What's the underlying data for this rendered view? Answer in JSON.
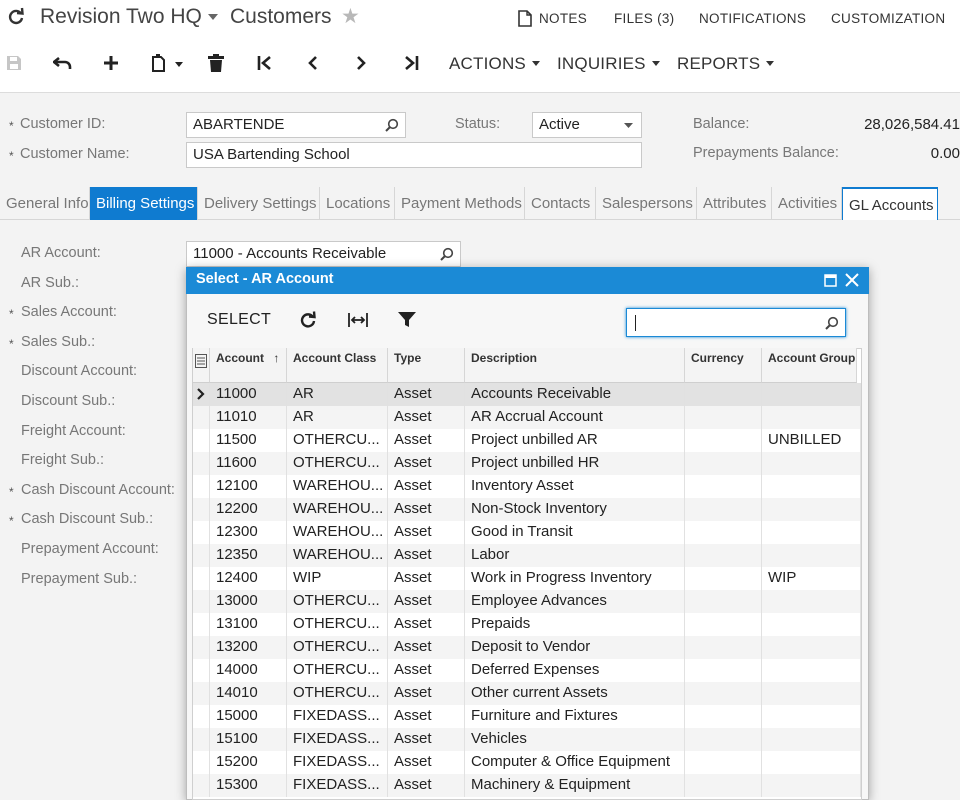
{
  "header": {
    "company": "Revision Two HQ",
    "screen_title": "Customers",
    "links": [
      "NOTES",
      "FILES (3)",
      "NOTIFICATIONS",
      "CUSTOMIZATION"
    ]
  },
  "toolbar": {
    "menus": [
      "ACTIONS",
      "INQUIRIES",
      "REPORTS"
    ]
  },
  "form": {
    "customer_id_label": "Customer ID:",
    "customer_id_value": "ABARTENDE",
    "customer_name_label": "Customer Name:",
    "customer_name_value": "USA Bartending School",
    "status_label": "Status:",
    "status_value": "Active",
    "balance_label": "Balance:",
    "balance_value": "28,026,584.41",
    "prepayments_label": "Prepayments Balance:",
    "prepayments_value": "0.00",
    "required_mark": "*"
  },
  "tabs": [
    "General Info",
    "Billing Settings",
    "Delivery Settings",
    "Locations",
    "Payment Methods",
    "Contacts",
    "Salespersons",
    "Attributes",
    "Activities",
    "GL Accounts"
  ],
  "gl_fields": [
    {
      "label": "AR Account:",
      "required": false
    },
    {
      "label": "AR Sub.:",
      "required": false
    },
    {
      "label": "Sales Account:",
      "required": true
    },
    {
      "label": "Sales Sub.:",
      "required": true
    },
    {
      "label": "Discount Account:",
      "required": false
    },
    {
      "label": "Discount Sub.:",
      "required": false
    },
    {
      "label": "Freight Account:",
      "required": false
    },
    {
      "label": "Freight Sub.:",
      "required": false
    },
    {
      "label": "Cash Discount Account:",
      "required": true
    },
    {
      "label": "Cash Discount Sub.:",
      "required": true
    },
    {
      "label": "Prepayment Account:",
      "required": false
    },
    {
      "label": "Prepayment Sub.:",
      "required": false
    }
  ],
  "ar_account_value": "11000 - Accounts Receivable",
  "dialog": {
    "title": "Select - AR Account",
    "select_label": "SELECT",
    "search_value": "",
    "columns": [
      "Account",
      "Account Class",
      "Type",
      "Description",
      "Currency",
      "Account Group"
    ],
    "sort_indicator": "↑",
    "rows": [
      [
        "11000",
        "AR",
        "Asset",
        "Accounts Receivable",
        "",
        ""
      ],
      [
        "11010",
        "AR",
        "Asset",
        "AR Accrual Account",
        "",
        ""
      ],
      [
        "11500",
        "OTHERCU...",
        "Asset",
        "Project unbilled AR",
        "",
        "UNBILLED"
      ],
      [
        "11600",
        "OTHERCU...",
        "Asset",
        "Project unbilled HR",
        "",
        ""
      ],
      [
        "12100",
        "WAREHOU...",
        "Asset",
        "Inventory Asset",
        "",
        ""
      ],
      [
        "12200",
        "WAREHOU...",
        "Asset",
        "Non-Stock Inventory",
        "",
        ""
      ],
      [
        "12300",
        "WAREHOU...",
        "Asset",
        "Good in Transit",
        "",
        ""
      ],
      [
        "12350",
        "WAREHOU...",
        "Asset",
        "Labor",
        "",
        ""
      ],
      [
        "12400",
        "WIP",
        "Asset",
        "Work in Progress Inventory",
        "",
        "WIP"
      ],
      [
        "13000",
        "OTHERCU...",
        "Asset",
        "Employee Advances",
        "",
        ""
      ],
      [
        "13100",
        "OTHERCU...",
        "Asset",
        "Prepaids",
        "",
        ""
      ],
      [
        "13200",
        "OTHERCU...",
        "Asset",
        "Deposit to Vendor",
        "",
        ""
      ],
      [
        "14000",
        "OTHERCU...",
        "Asset",
        "Deferred Expenses",
        "",
        ""
      ],
      [
        "14010",
        "OTHERCU...",
        "Asset",
        "Other current Assets",
        "",
        ""
      ],
      [
        "15000",
        "FIXEDASS...",
        "Asset",
        "Furniture and Fixtures",
        "",
        ""
      ],
      [
        "15100",
        "FIXEDASS...",
        "Asset",
        "Vehicles",
        "",
        ""
      ],
      [
        "15200",
        "FIXEDASS...",
        "Asset",
        "Computer & Office Equipment",
        "",
        ""
      ],
      [
        "15300",
        "FIXEDASS...",
        "Asset",
        "Machinery & Equipment",
        "",
        ""
      ]
    ],
    "selected_row": 0
  },
  "colors": {
    "accent": "#0f7bd0",
    "dialog_header": "#1b8ad6",
    "selected_row": "#e2e2e2",
    "alt_row": "#f4f4f4"
  }
}
